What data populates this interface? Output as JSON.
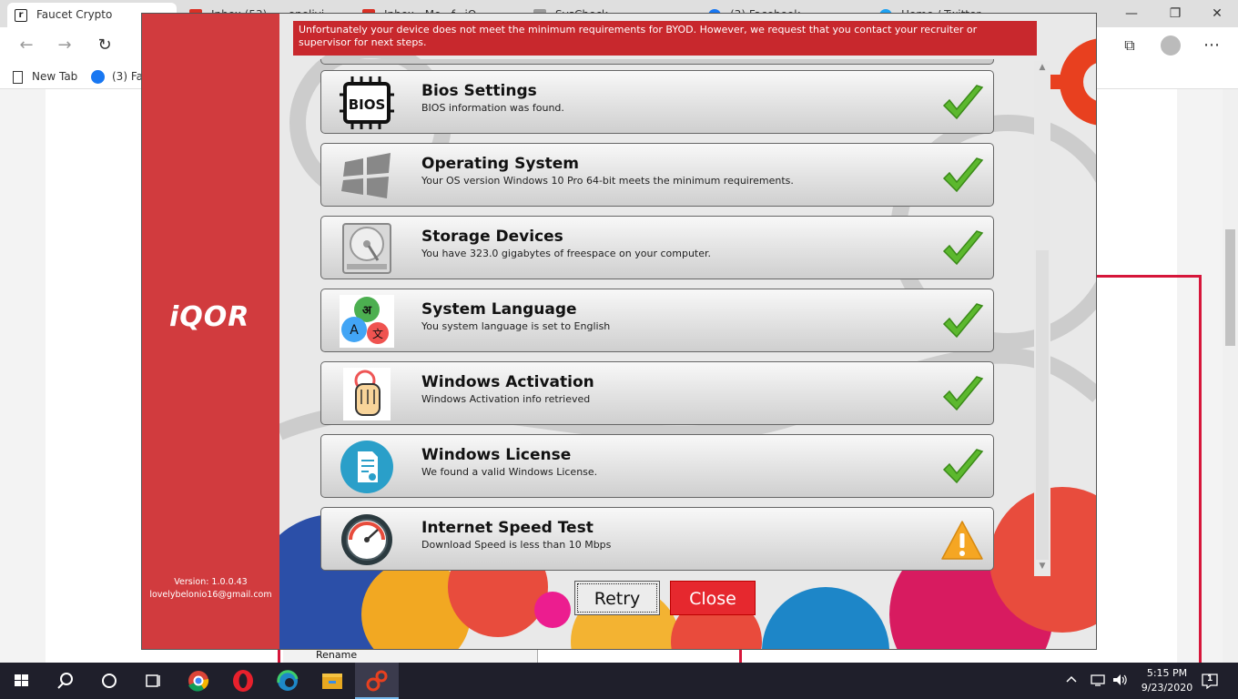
{
  "browser": {
    "tabs": [
      {
        "label": "Faucet Crypto",
        "fav_color": "#222222"
      },
      {
        "label": "Inbox (53) - ...enelivi...",
        "fav_color": "#d93025"
      },
      {
        "label": "Inbox - Mo...f...iQ...",
        "fav_color": "#d93025"
      },
      {
        "label": "SysCheck",
        "fav_color": "#888888"
      },
      {
        "label": "(3) Facebook",
        "fav_color": "#1877f2"
      },
      {
        "label": "Home / Twitter",
        "fav_color": "#1da1f2"
      }
    ],
    "bookmarks": [
      {
        "label": "New Tab"
      },
      {
        "label": "(3) Fac"
      }
    ],
    "window_controls": {
      "minimize": "—",
      "maximize": "❐",
      "close": "✕"
    },
    "menu": "⋯"
  },
  "app": {
    "logo": "iQOR",
    "version": "Version: 1.0.0.43",
    "user_email": "lovelybelonio16@gmail.com",
    "banner": "Unfortunately your device does not meet the minimum requirements for BYOD. However, we request that you contact your recruiter or supervisor for next steps.",
    "checks": [
      {
        "title": "Bios Settings",
        "desc": "BIOS information was found.",
        "icon": "bios-icon",
        "status": "pass"
      },
      {
        "title": "Operating System",
        "desc": "Your OS version Windows 10 Pro 64-bit meets the minimum requirements.",
        "icon": "windows-logo-icon",
        "status": "pass"
      },
      {
        "title": "Storage Devices",
        "desc": "You have 323.0 gigabytes of freespace on your computer.",
        "icon": "hard-drive-icon",
        "status": "pass"
      },
      {
        "title": "System Language",
        "desc": "You system language is set to English",
        "icon": "language-icon",
        "status": "pass"
      },
      {
        "title": "Windows Activation",
        "desc": "Windows Activation info retrieved",
        "icon": "touch-activation-icon",
        "status": "pass"
      },
      {
        "title": "Windows License",
        "desc": "We found a valid Windows License.",
        "icon": "license-document-icon",
        "status": "pass"
      },
      {
        "title": "Internet Speed Test",
        "desc": "Download Speed is less than 10 Mbps",
        "icon": "speedometer-icon",
        "status": "warning"
      }
    ],
    "retry_label": "Retry",
    "close_label": "Close"
  },
  "background_window": {
    "rename_label": "Rename"
  },
  "taskbar": {
    "time": "5:15 PM",
    "date": "9/23/2020",
    "notifications": "1"
  },
  "colors": {
    "brand_red": "#d13b3e",
    "banner_red": "#c8282d",
    "pass_green": "#5cb82e",
    "warn_yellow": "#f5a623"
  }
}
